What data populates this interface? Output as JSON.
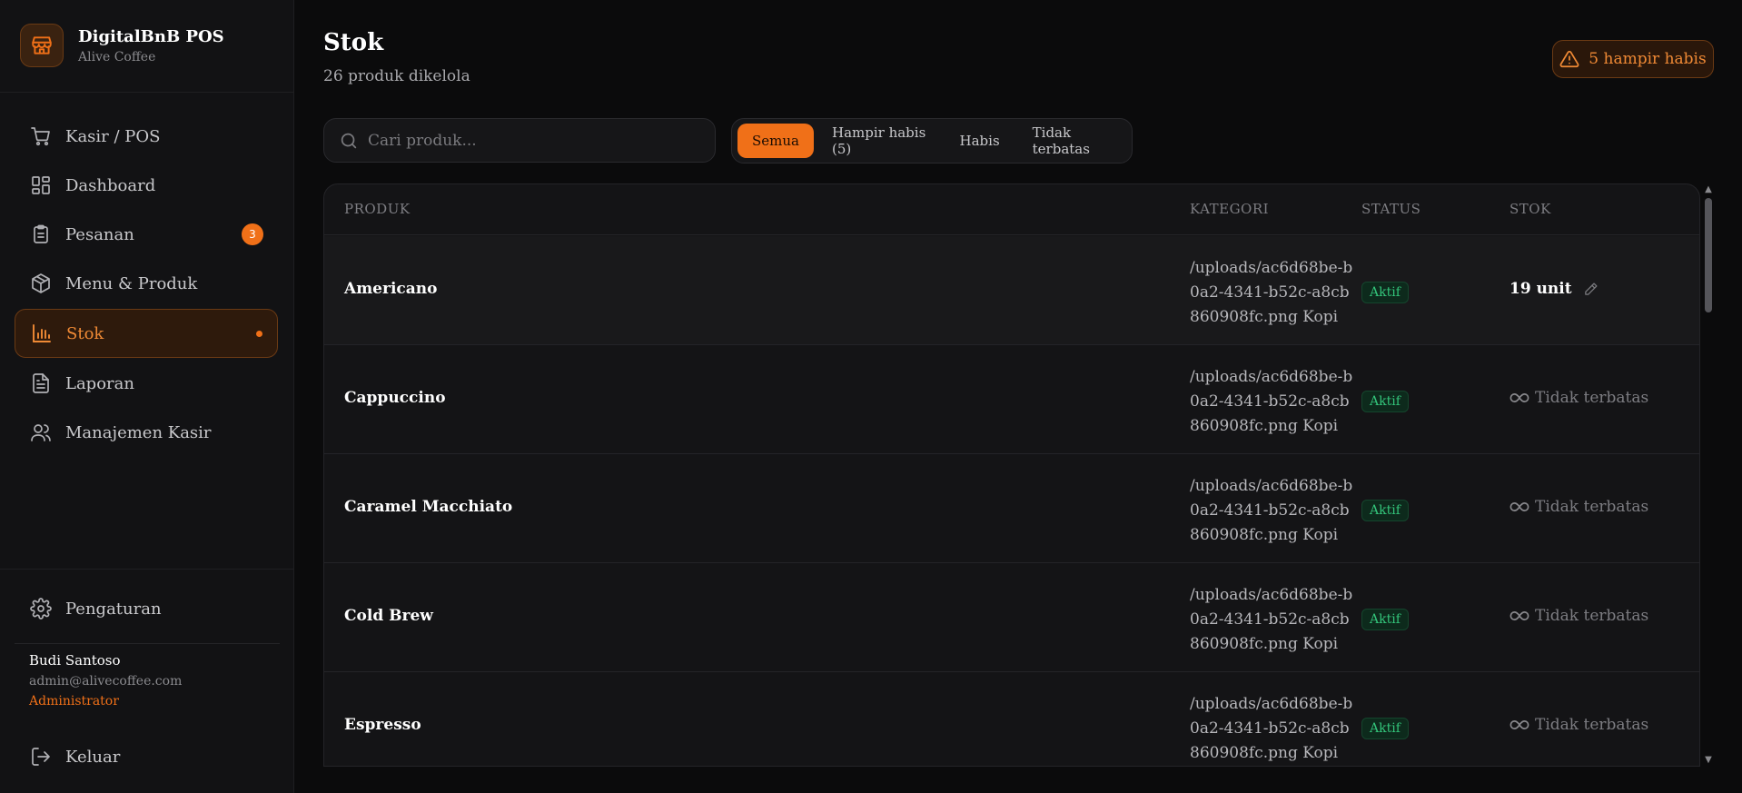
{
  "brand": {
    "title": "DigitalBnB POS",
    "subtitle": "Alive Coffee"
  },
  "nav": {
    "items": [
      {
        "label": "Kasir / POS",
        "icon": "cart-icon"
      },
      {
        "label": "Dashboard",
        "icon": "dashboard-grid-icon"
      },
      {
        "label": "Pesanan",
        "icon": "clipboard-icon",
        "badge": "3"
      },
      {
        "label": "Menu & Produk",
        "icon": "package-icon"
      },
      {
        "label": "Stok",
        "icon": "bar-chart-icon",
        "active": true
      },
      {
        "label": "Laporan",
        "icon": "file-text-icon"
      },
      {
        "label": "Manajemen Kasir",
        "icon": "users-icon"
      }
    ],
    "settings_label": "Pengaturan",
    "logout_label": "Keluar"
  },
  "user": {
    "name": "Budi Santoso",
    "email": "admin@alivecoffee.com",
    "role": "Administrator"
  },
  "header": {
    "title": "Stok",
    "subtitle": "26 produk dikelola",
    "alert_label": "5 hampir habis"
  },
  "search": {
    "placeholder": "Cari produk..."
  },
  "filters": [
    "Semua",
    "Hampir habis (5)",
    "Habis",
    "Tidak terbatas"
  ],
  "table": {
    "headers": [
      "PRODUK",
      "KATEGORI",
      "STATUS",
      "STOK"
    ],
    "rows": [
      {
        "name": "Americano",
        "category": "/uploads/ac6d68be-b0a2-4341-b52c-a8cb860908fc.png Kopi",
        "status": "Aktif",
        "stock": "19 unit"
      },
      {
        "name": "Cappuccino",
        "category": "/uploads/ac6d68be-b0a2-4341-b52c-a8cb860908fc.png Kopi",
        "status": "Aktif",
        "stock": "Tidak terbatas"
      },
      {
        "name": "Caramel Macchiato",
        "category": "/uploads/ac6d68be-b0a2-4341-b52c-a8cb860908fc.png Kopi",
        "status": "Aktif",
        "stock": "Tidak terbatas"
      },
      {
        "name": "Cold Brew",
        "category": "/uploads/ac6d68be-b0a2-4341-b52c-a8cb860908fc.png Kopi",
        "status": "Aktif",
        "stock": "Tidak terbatas"
      },
      {
        "name": "Espresso",
        "category": "/uploads/ac6d68be-b0a2-4341-b52c-a8cb860908fc.png Kopi",
        "status": "Aktif",
        "stock": "Tidak terbatas"
      }
    ]
  },
  "colors": {
    "accent": "#f07018",
    "success": "#33c47a",
    "background": "#0b0b0c",
    "sidebar": "#121214"
  }
}
